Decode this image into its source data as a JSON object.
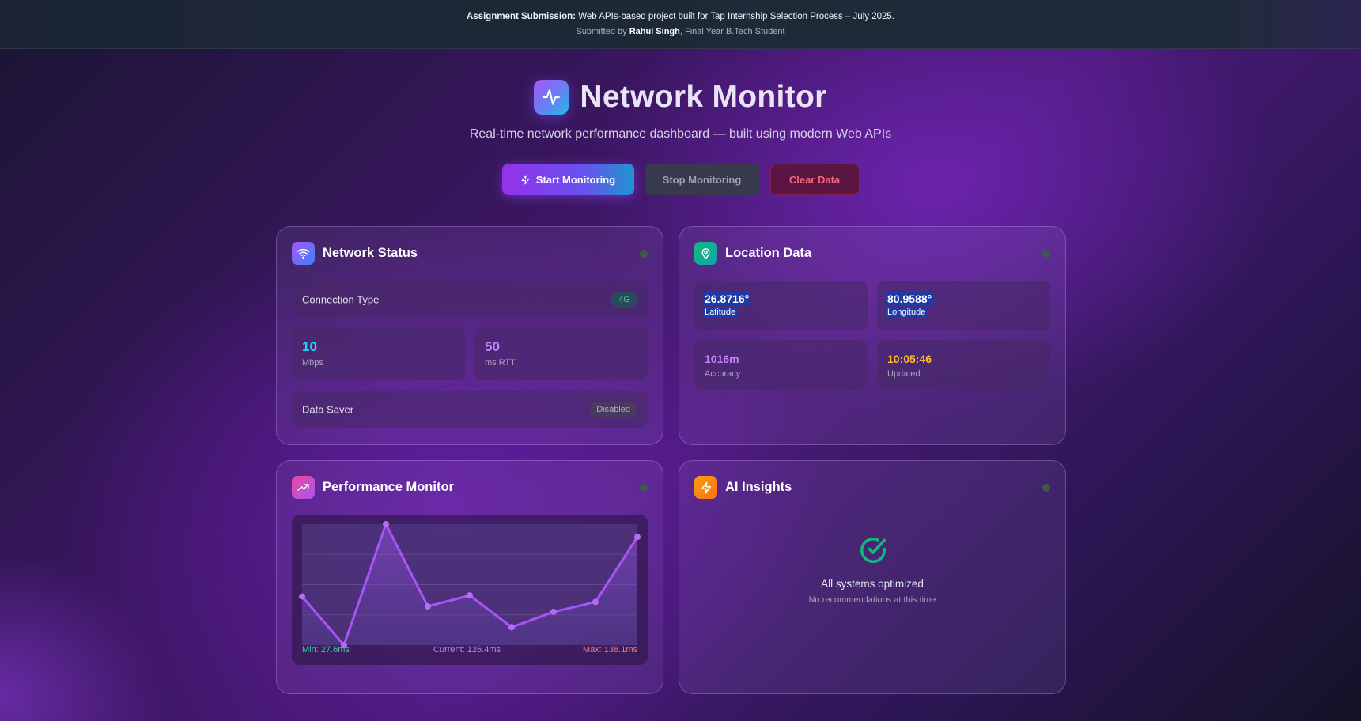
{
  "banner": {
    "lead": "Assignment Submission:",
    "text": " Web APIs-based project built for Tap Internship Selection Process – July 2025.",
    "submitted_prefix": "Submitted by ",
    "author": "Rahul Singh",
    "submitted_suffix": ", Final Year B.Tech Student"
  },
  "header": {
    "title": "Network Monitor",
    "subtitle": "Real-time network performance dashboard — built using modern Web APIs",
    "logo_icon": "activity-pulse-icon"
  },
  "controls": {
    "start_label": "Start Monitoring",
    "stop_label": "Stop Monitoring",
    "clear_label": "Clear Data"
  },
  "network_status": {
    "title": "Network Status",
    "icon": "wifi-icon",
    "connection_label": "Connection Type",
    "connection_value": "4G",
    "bandwidth_value": "10",
    "bandwidth_unit": "Mbps",
    "rtt_value": "50",
    "rtt_unit": "ms RTT",
    "data_saver_label": "Data Saver",
    "data_saver_value": "Disabled"
  },
  "location": {
    "title": "Location Data",
    "icon": "map-pin-icon",
    "latitude": "26.8716°",
    "latitude_label": "Latitude",
    "longitude": "80.9588°",
    "longitude_label": "Longitude",
    "accuracy": "1016m",
    "accuracy_label": "Accuracy",
    "updated": "10:05:46",
    "updated_label": "Updated"
  },
  "performance": {
    "title": "Performance Monitor",
    "icon": "trending-up-icon",
    "min_label": "Min: 27.6ms",
    "current_label": "Current: 126.4ms",
    "max_label": "Max: 138.1ms"
  },
  "insights": {
    "title": "AI Insights",
    "icon": "lightning-bolt-icon",
    "status_title": "All systems optimized",
    "status_sub": "No recommendations at this time"
  },
  "colors": {
    "accent_purple": "#a855f7",
    "accent_cyan": "#22d3ee",
    "accent_green": "#10b981",
    "accent_amber": "#f59e0b",
    "danger": "#f87171"
  },
  "chart_data": {
    "type": "line",
    "x": [
      1,
      2,
      3,
      4,
      5,
      6,
      7,
      8,
      9
    ],
    "values": [
      72,
      27.6,
      138.1,
      63,
      73,
      44,
      58,
      67,
      126.4
    ],
    "ylim": [
      27.6,
      138.1
    ],
    "grid": true
  }
}
